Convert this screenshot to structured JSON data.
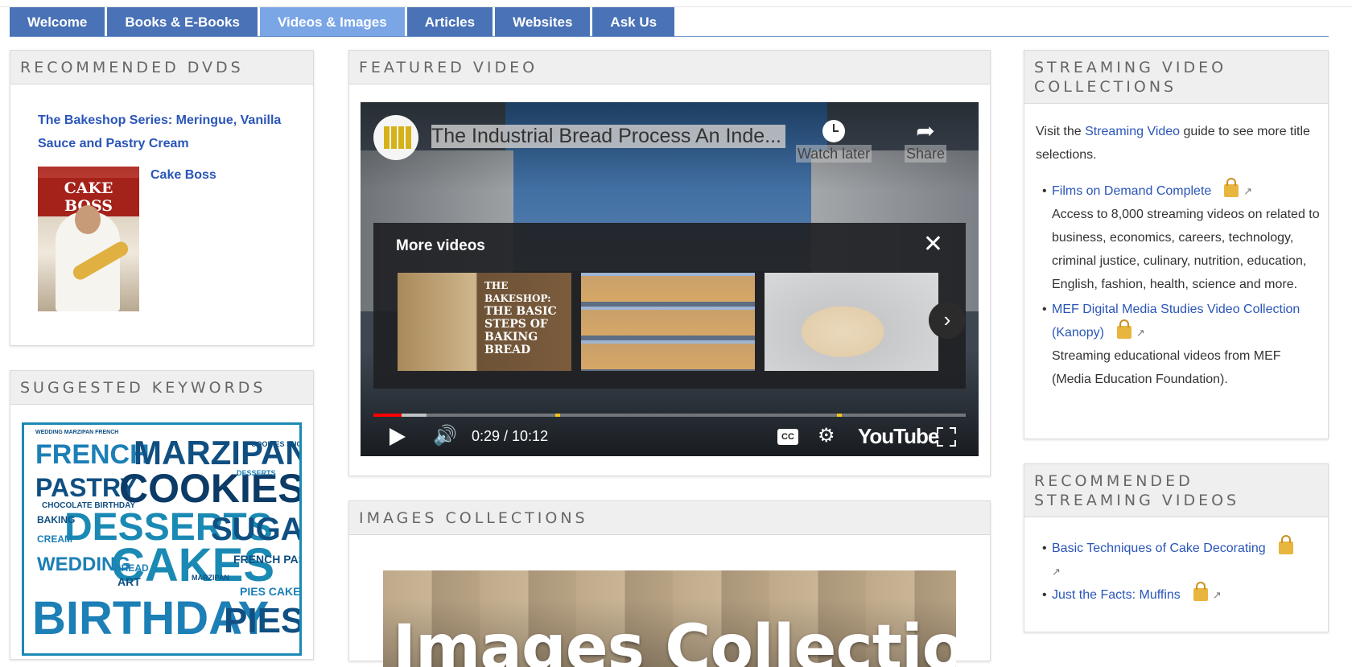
{
  "tabs": [
    {
      "label": "Welcome",
      "active": false
    },
    {
      "label": "Books & E-Books",
      "active": false
    },
    {
      "label": "Videos & Images",
      "active": true
    },
    {
      "label": "Articles",
      "active": false
    },
    {
      "label": "Websites",
      "active": false
    },
    {
      "label": "Ask Us",
      "active": false
    }
  ],
  "dvds": {
    "heading": "Recommended DVDs",
    "items": [
      {
        "title": "The Bakeshop Series: Meringue, Vanilla Sauce and Pastry Cream"
      },
      {
        "title": "Cake Boss",
        "cover_text": "CAKE BOSS"
      }
    ]
  },
  "keywords": {
    "heading": "Suggested Keywords",
    "cloud": [
      "FRENCH",
      "MARZIPAN",
      "PASTRY",
      "COOKIES",
      "DESSERTS",
      "SUGAR",
      "WEDDING",
      "CAKES",
      "BIRTHDAY",
      "PIES",
      "CHOCOLATE BIRTHDAY",
      "BAKING",
      "CREAM",
      "BREAD",
      "ART",
      "WEDDING MARZIPAN FRENCH",
      "DESSERTS",
      "COOKIES SUGAR",
      "MARZIPAN",
      "FRENCH PASTRY",
      "PIES CAKES"
    ]
  },
  "video": {
    "heading": "Featured Video",
    "title": "The Industrial Bread Process An Inde...",
    "watch_later": "Watch later",
    "share": "Share",
    "more_videos": "More videos",
    "thumb1_title_small": "THE BAKESHOP:",
    "thumb1_title": "THE BASIC STEPS OF BAKING BREAD",
    "time": "0:29 / 10:12",
    "progress": 0.047,
    "buffered": 0.09,
    "youtube": "YouTube",
    "cc": "CC"
  },
  "images": {
    "heading": "Images Collections",
    "banner": "Images Collection"
  },
  "streaming": {
    "heading": "Streaming Video Collections",
    "intro_pre": "Visit the ",
    "intro_link": "Streaming Video",
    "intro_post": " guide to see more title selections.",
    "items": [
      {
        "link": "Films on Demand Complete",
        "desc": "Access to 8,000 streaming videos on related to business, economics, careers, technology, criminal justice, culinary, nutrition, education, English, fashion, health, science and more."
      },
      {
        "link": "MEF Digital Media Studies Video Collection (Kanopy)",
        "desc": "Streaming educational videos from MEF (Media Education Foundation)."
      }
    ]
  },
  "recommended_streaming": {
    "heading": "Recommended Streaming Videos",
    "items": [
      {
        "link": "Basic Techniques of Cake Decorating"
      },
      {
        "link": "Just the Facts: Muffins"
      }
    ]
  },
  "colors": {
    "tab": "#4a72b6",
    "tab_active": "#7aa6e6",
    "link": "#2a55b8",
    "progress": "#ff0000"
  },
  "icons": {
    "lock": "lock-icon",
    "external": "external-link-icon",
    "play": "play-icon",
    "volume": "volume-icon",
    "settings": "gear-icon",
    "fullscreen": "fullscreen-icon",
    "close": "close-icon",
    "next": "chevron-right-icon",
    "watch_later": "clock-icon",
    "share": "share-icon"
  }
}
